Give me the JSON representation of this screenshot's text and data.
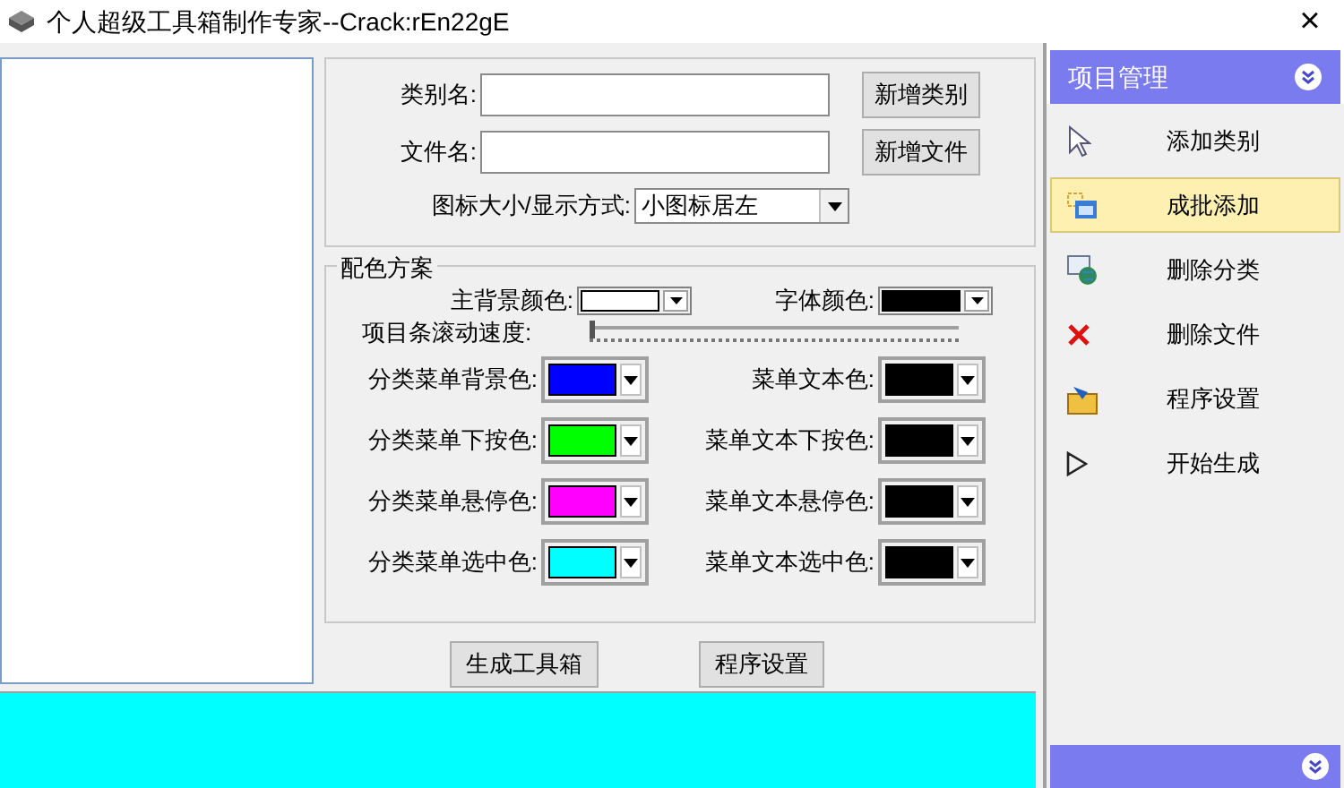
{
  "window": {
    "title": "个人超级工具箱制作专家--Crack:rEn22gE",
    "close": "×"
  },
  "form": {
    "fields": [
      {
        "label": "类别名:",
        "button": "新增类别"
      },
      {
        "label": "文件名:",
        "button": "新增文件"
      }
    ],
    "display_mode": {
      "label": "图标大小/显示方式:",
      "value": "小图标居左"
    }
  },
  "color_scheme": {
    "title": "配色方案",
    "top": [
      {
        "label": "主背景颜色:",
        "color": "#ffffff"
      },
      {
        "label": "字体颜色:",
        "color": "#000000"
      }
    ],
    "speed": {
      "label": "项目条滚动速度:",
      "level": 0
    },
    "rows": [
      [
        {
          "label": "分类菜单背景色:",
          "color": "#0000ff"
        },
        {
          "label": "菜单文本色:",
          "color": "#000000"
        }
      ],
      [
        {
          "label": "分类菜单下按色:",
          "color": "#00ff00"
        },
        {
          "label": "菜单文本下按色:",
          "color": "#000000"
        }
      ],
      [
        {
          "label": "分类菜单悬停色:",
          "color": "#ff00ff"
        },
        {
          "label": "菜单文本悬停色:",
          "color": "#000000"
        }
      ],
      [
        {
          "label": "分类菜单选中色:",
          "color": "#00ffff"
        },
        {
          "label": "菜单文本选中色:",
          "color": "#000000"
        }
      ]
    ]
  },
  "buttons": [
    "生成工具箱",
    "程序设置"
  ],
  "preview": {
    "color": "#00ffff"
  },
  "sidebar": {
    "title": "项目管理",
    "items": [
      {
        "label": "添加类别",
        "kind": "cursor",
        "selected": false
      },
      {
        "label": "成批添加",
        "kind": "batch",
        "selected": true
      },
      {
        "label": "删除分类",
        "kind": "globe",
        "selected": false
      },
      {
        "label": "删除文件",
        "kind": "cross",
        "selected": false
      },
      {
        "label": "程序设置",
        "kind": "folder",
        "selected": false
      },
      {
        "label": "开始生成",
        "kind": "play",
        "selected": false
      }
    ]
  }
}
